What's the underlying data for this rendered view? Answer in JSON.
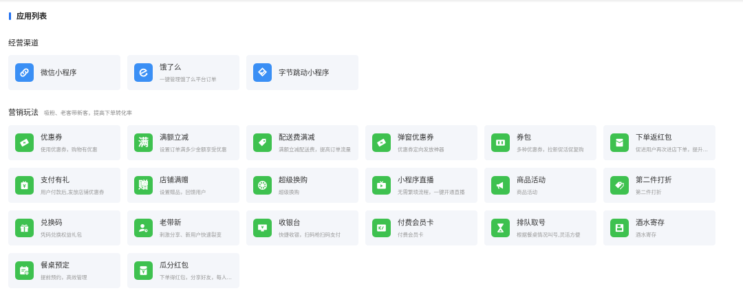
{
  "page_title": "应用列表",
  "sections": [
    {
      "title": "经营渠道",
      "subtitle": ""
    },
    {
      "title": "营销玩法",
      "subtitle": "吸粉、老客带新客，提高下单转化率"
    }
  ],
  "channel_cards": [
    {
      "name": "微信小程序",
      "desc": "",
      "icon": "link-icon",
      "color": "#3a8ff5"
    },
    {
      "name": "饿了么",
      "desc": "一键管理饿了么平台订单",
      "icon": "eleme-icon",
      "color": "#3a8ff5"
    },
    {
      "name": "字节跳动小程序",
      "desc": "",
      "icon": "bytedance-icon",
      "color": "#3a8ff5"
    }
  ],
  "marketing_cards": [
    {
      "name": "优惠券",
      "desc": "使用优惠券，购物有优惠",
      "icon": "coupon-icon",
      "color": "#3ec14f"
    },
    {
      "name": "满额立减",
      "desc": "设置订单满多少金额享受优惠",
      "icon": "man-icon",
      "glyph": "满",
      "color": "#3ec14f"
    },
    {
      "name": "配送费满减",
      "desc": "满额立减配送费，提高订单流量",
      "icon": "tag-icon",
      "color": "#3ec14f"
    },
    {
      "name": "弹窗优惠券",
      "desc": "优惠券定向发放神器",
      "icon": "popup-coupon-icon",
      "color": "#3ec14f"
    },
    {
      "name": "券包",
      "desc": "多种优惠券，拉新促活促复购",
      "icon": "coupon-pack-icon",
      "color": "#3ec14f"
    },
    {
      "name": "下单返红包",
      "desc": "促进用户再次进店下单，提升复购",
      "icon": "red-envelope-icon",
      "color": "#3ec14f"
    },
    {
      "name": "支付有礼",
      "desc": "用户付款后,发放店铺优惠券",
      "icon": "pay-gift-icon",
      "color": "#3ec14f"
    },
    {
      "name": "店铺满赠",
      "desc": "设置赠品，回馈用户",
      "icon": "zeng-icon",
      "glyph": "赠",
      "color": "#3ec14f"
    },
    {
      "name": "超级换购",
      "desc": "超级换购",
      "icon": "exchange-icon",
      "color": "#3ec14f"
    },
    {
      "name": "小程序直播",
      "desc": "无需繁琐流程，一键开通直播",
      "icon": "live-icon",
      "color": "#3ec14f"
    },
    {
      "name": "商品活动",
      "desc": "商品活动",
      "icon": "megaphone-icon",
      "color": "#3ec14f"
    },
    {
      "name": "第二件打折",
      "desc": "第二件打折",
      "icon": "discount-tag-icon",
      "color": "#3ec14f"
    },
    {
      "name": "兑换码",
      "desc": "凭码兑换权益礼包",
      "icon": "gift-box-icon",
      "color": "#3ec14f"
    },
    {
      "name": "老带新",
      "desc": "刺激分享、新用户快速裂变",
      "icon": "user-referral-icon",
      "color": "#3ec14f"
    },
    {
      "name": "收银台",
      "desc": "快捷收银，扫码枪扫码支付",
      "icon": "cashier-icon",
      "color": "#3ec14f"
    },
    {
      "name": "付费会员卡",
      "desc": "付费会员卡",
      "icon": "vip-card-icon",
      "color": "#3ec14f"
    },
    {
      "name": "排队取号",
      "desc": "根据餐桌情况叫号,灵活方便",
      "icon": "hourglass-icon",
      "color": "#3ec14f"
    },
    {
      "name": "酒水寄存",
      "desc": "酒水寄存",
      "icon": "storage-icon",
      "color": "#3ec14f"
    },
    {
      "name": "餐桌预定",
      "desc": "提前预约，高效管理",
      "icon": "calendar-icon",
      "color": "#3ec14f"
    },
    {
      "name": "瓜分红包",
      "desc": "下单得红包，分享好友，每人一份",
      "icon": "split-envelope-icon",
      "color": "#3ec14f"
    }
  ]
}
